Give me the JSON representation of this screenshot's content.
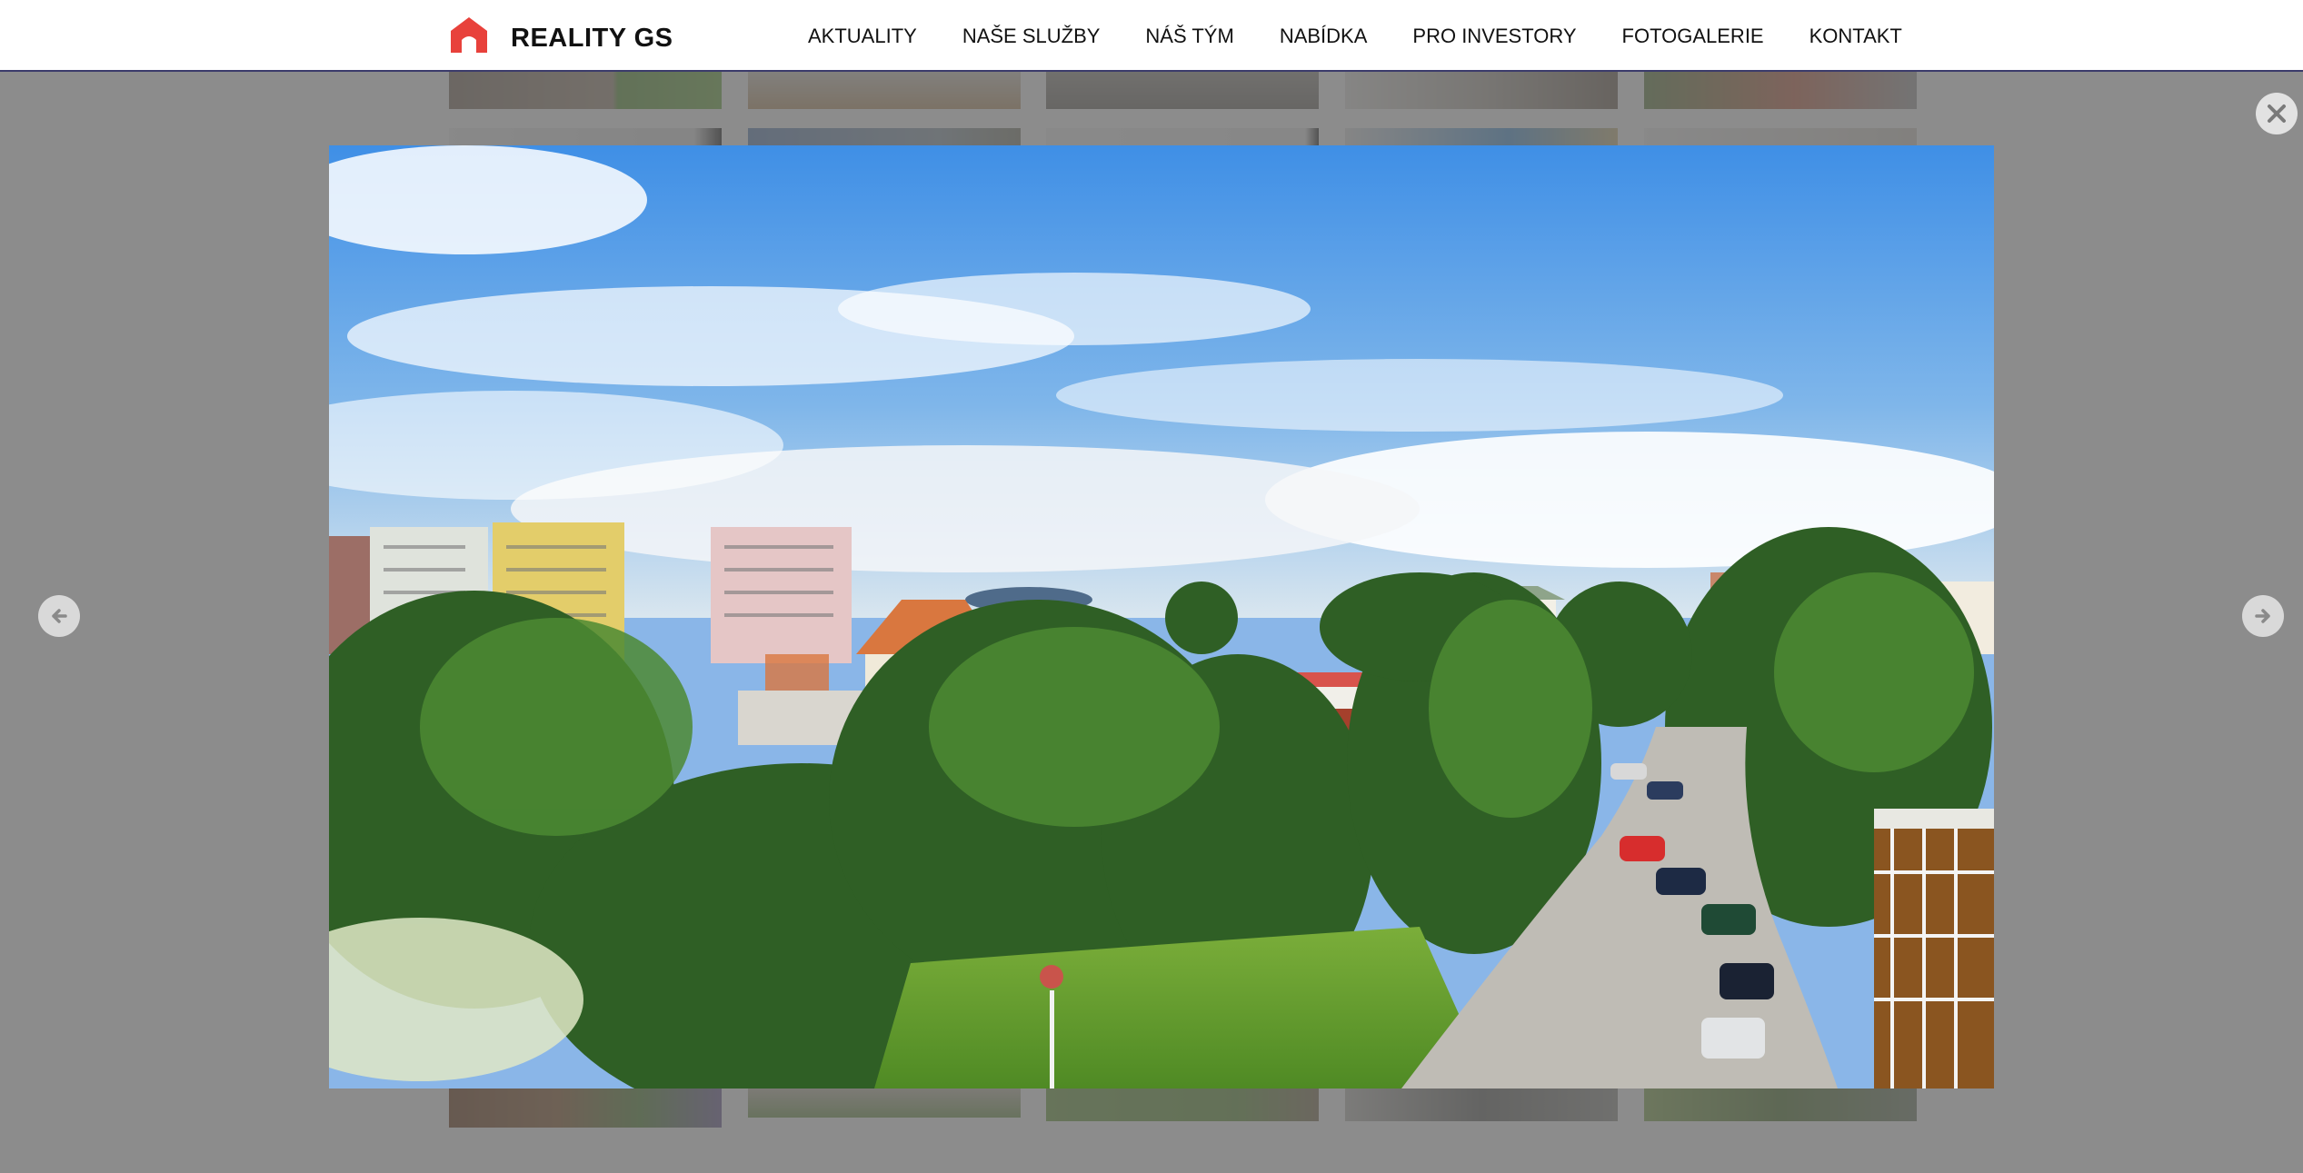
{
  "header": {
    "brand": "REALITY GS",
    "logo_icon": "house-icon",
    "brand_color": "#e8413b",
    "nav": [
      "AKTUALITY",
      "NAŠE SLUŽBY",
      "NÁŠ TÝM",
      "NABÍDKA",
      "PRO INVESTORY",
      "FOTOGALERIE",
      "KONTAKT"
    ]
  },
  "lightbox": {
    "image_description_icon": "city-panorama-photo",
    "close_icon": "close-icon",
    "prev_icon": "arrow-left-icon",
    "next_icon": "arrow-right-icon",
    "overlay_color": "#5f5f5f"
  }
}
